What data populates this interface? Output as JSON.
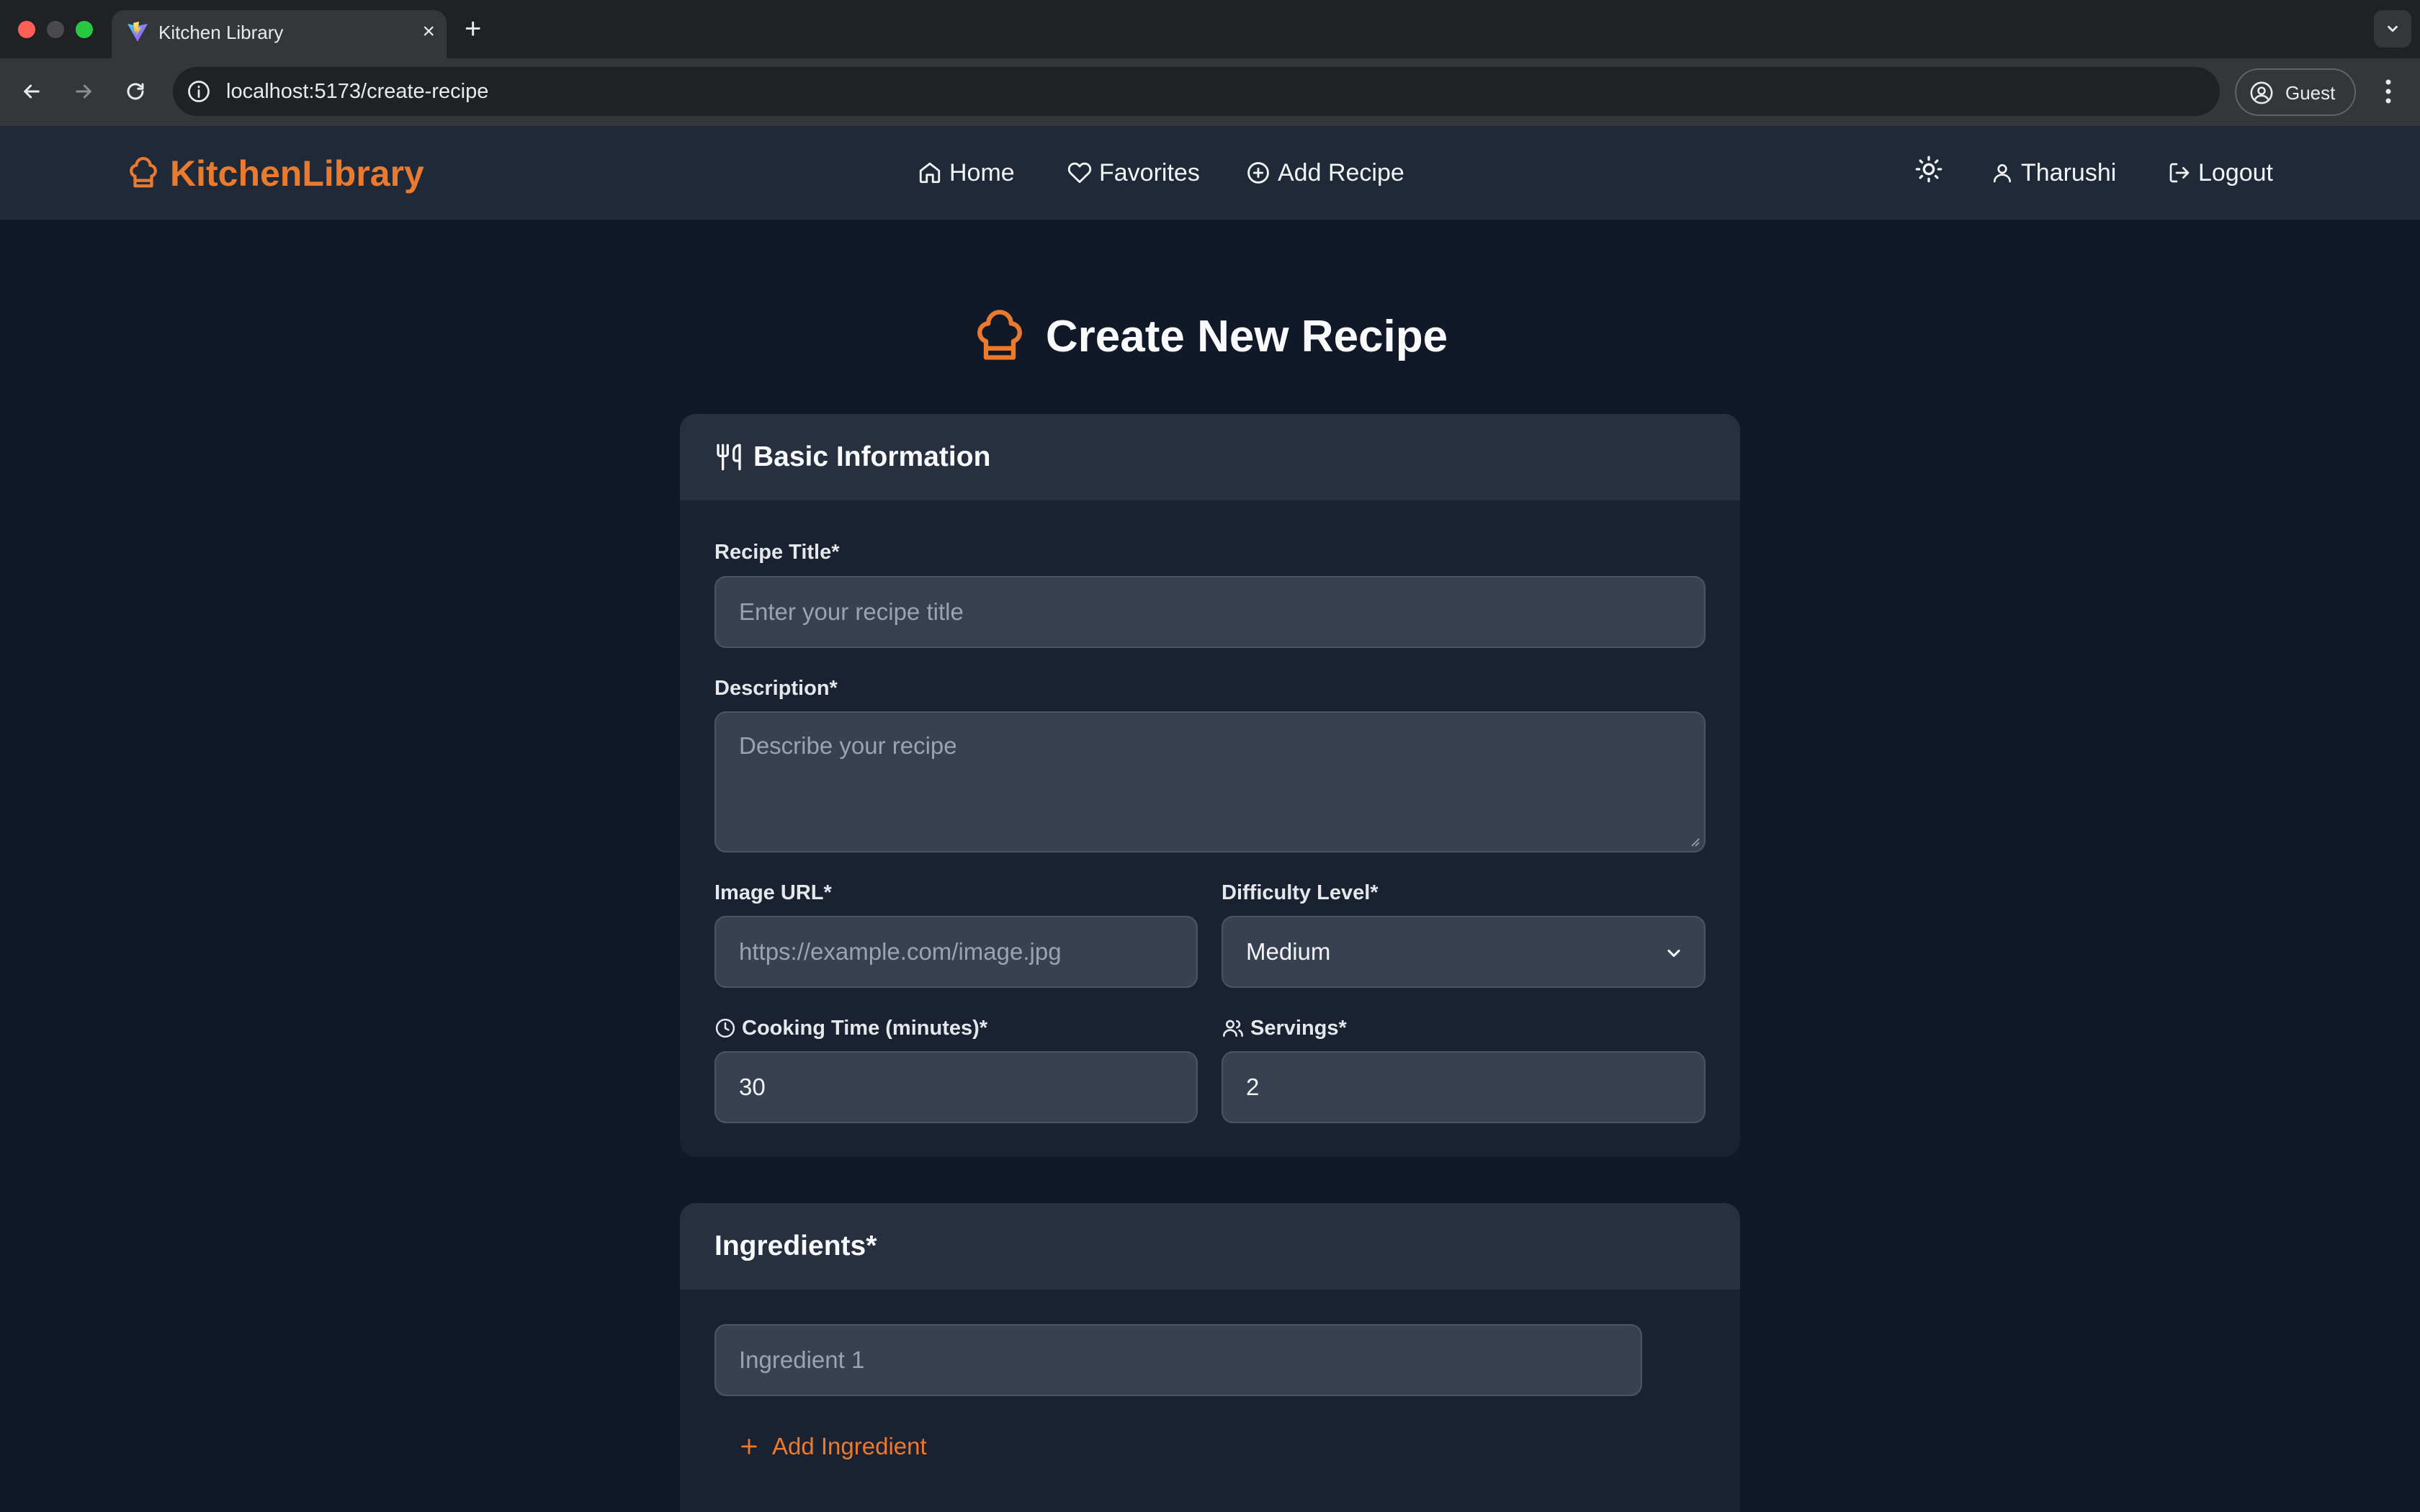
{
  "browser": {
    "tab_title": "Kitchen Library",
    "tab_close": "×",
    "new_tab": "+",
    "url": "localhost:5173/create-recipe",
    "profile_label": "Guest"
  },
  "header": {
    "brand": "KitchenLibrary",
    "nav": {
      "home": "Home",
      "favorites": "Favorites",
      "add_recipe": "Add Recipe"
    },
    "user": "Tharushi",
    "logout": "Logout"
  },
  "page": {
    "title": "Create New Recipe"
  },
  "basic_info": {
    "heading": "Basic Information",
    "recipe_title_label": "Recipe Title*",
    "recipe_title_placeholder": "Enter your recipe title",
    "description_label": "Description*",
    "description_placeholder": "Describe your recipe",
    "image_url_label": "Image URL*",
    "image_url_placeholder": "https://example.com/image.jpg",
    "difficulty_label": "Difficulty Level*",
    "difficulty_value": "Medium",
    "cooking_time_label": "Cooking Time (minutes)*",
    "cooking_time_value": "30",
    "servings_label": "Servings*",
    "servings_value": "2"
  },
  "ingredients": {
    "heading": "Ingredients*",
    "items": [
      {
        "placeholder": "Ingredient 1"
      }
    ],
    "add_label": "Add Ingredient"
  },
  "colors": {
    "accent": "#ea7a2e",
    "page_bg": "#111827",
    "header_bg": "#1f2937",
    "card_bg": "#1a2130",
    "card_head_bg": "#283040",
    "input_bg": "#374151"
  },
  "icons": {
    "brand": "chef-hat-icon",
    "home": "home-icon",
    "favorites": "heart-icon",
    "add_recipe": "plus-circle-icon",
    "theme": "sun-icon",
    "user": "user-icon",
    "logout": "logout-icon",
    "basic_info": "utensils-icon",
    "cooking_time": "clock-icon",
    "servings": "users-icon",
    "add_ingredient": "plus-icon"
  }
}
